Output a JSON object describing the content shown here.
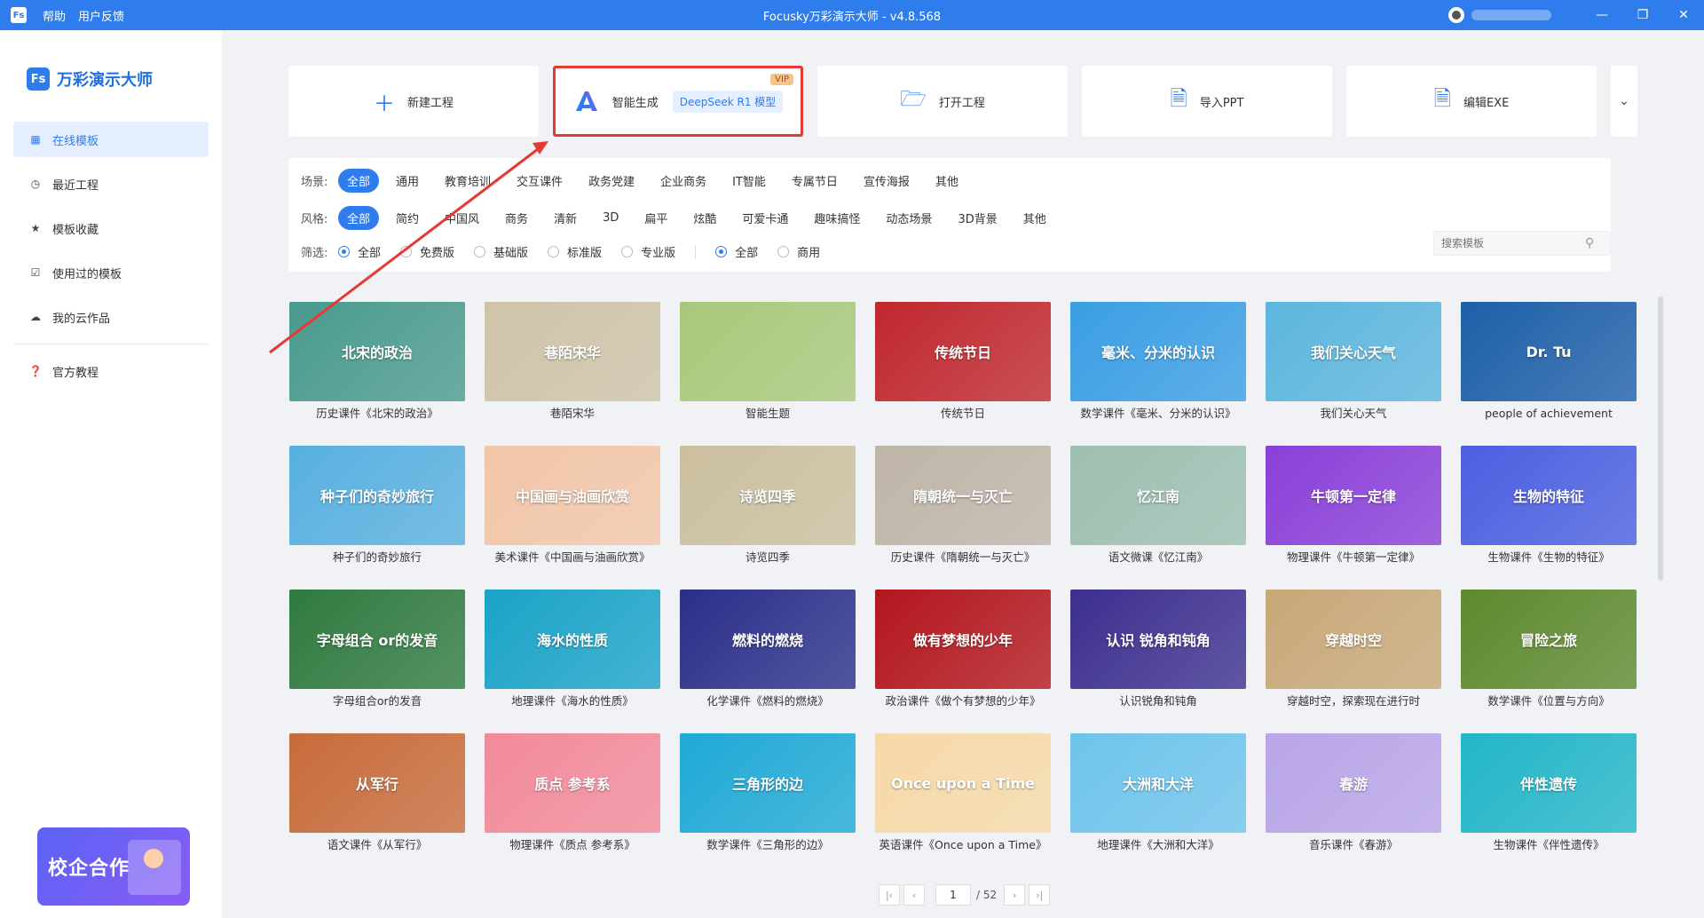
{
  "titlebar": {
    "logo": "Fs",
    "menu": [
      "帮助",
      "用户反馈"
    ],
    "title": "Focusky万彩演示大师 - v4.8.568",
    "controls": [
      "minimize-icon",
      "restore-icon",
      "close-icon"
    ]
  },
  "sidebar": {
    "brand_logo": "Fs",
    "brand_name": "万彩演示大师",
    "items": [
      {
        "label": "在线模板",
        "icon": "grid-icon",
        "active": true
      },
      {
        "label": "最近工程",
        "icon": "clock-icon"
      },
      {
        "label": "模板收藏",
        "icon": "star-icon"
      },
      {
        "label": "使用过的模板",
        "icon": "checkbox-icon"
      },
      {
        "label": "我的云作品",
        "icon": "cloud-icon"
      },
      {
        "label": "官方教程",
        "icon": "help-icon"
      }
    ],
    "promo": "校企合作"
  },
  "actions": {
    "new": "新建工程",
    "ai": "智能生成",
    "ai_badge": "DeepSeek R1 模型",
    "vip": "VIP",
    "open": "打开工程",
    "import": "导入PPT",
    "edit": "编辑EXE"
  },
  "filters": {
    "scene_label": "场景:",
    "scenes": [
      "全部",
      "通用",
      "教育培训",
      "交互课件",
      "政务党建",
      "企业商务",
      "IT智能",
      "专属节日",
      "宣传海报",
      "其他"
    ],
    "style_label": "风格:",
    "styles": [
      "全部",
      "简约",
      "中国风",
      "商务",
      "清新",
      "3D",
      "扁平",
      "炫酷",
      "可爱卡通",
      "趣味搞怪",
      "动态场景",
      "3D背景",
      "其他"
    ],
    "screen_label": "筛选:",
    "versions": [
      "全部",
      "免费版",
      "基础版",
      "标准版",
      "专业版"
    ],
    "usage": [
      "全部",
      "商用"
    ],
    "search_placeholder": "搜索模板"
  },
  "templates": [
    {
      "caption": "历史课件《北宋的政治》",
      "thumb": "北宋的政治",
      "color": "#4a9a8e"
    },
    {
      "caption": "巷陌宋华",
      "thumb": "巷陌宋华",
      "color": "#cfc3a8"
    },
    {
      "caption": "智能生题",
      "thumb": "",
      "color": "#a8c97a"
    },
    {
      "caption": "传统节日",
      "thumb": "传统节日",
      "color": "#c0272d"
    },
    {
      "caption": "数学课件《毫米、分米的认识》",
      "thumb": "毫米、分米的认识",
      "color": "#3a9ee4"
    },
    {
      "caption": "我们关心天气",
      "thumb": "我们关心天气",
      "color": "#5cb6de"
    },
    {
      "caption": "people of achievement",
      "thumb": "Dr. Tu",
      "color": "#1d5fa8"
    },
    {
      "caption": "种子们的奇妙旅行",
      "thumb": "种子们的奇妙旅行",
      "color": "#58b0e0"
    },
    {
      "caption": "美术课件《中国画与油画欣赏》",
      "thumb": "中国画与油画欣赏",
      "color": "#f2c6a8"
    },
    {
      "caption": "诗览四季",
      "thumb": "诗览四季",
      "color": "#cbbf9e"
    },
    {
      "caption": "历史课件《隋朝统一与灭亡》",
      "thumb": "隋朝统一与灭亡",
      "color": "#bfb5a8"
    },
    {
      "caption": "语文微课《忆江南》",
      "thumb": "忆江南",
      "color": "#9dbfb0"
    },
    {
      "caption": "物理课件《牛顿第一定律》",
      "thumb": "牛顿第一定律",
      "color": "#8a3fd8"
    },
    {
      "caption": "生物课件《生物的特征》",
      "thumb": "生物的特征",
      "color": "#4b5fe0"
    },
    {
      "caption": "字母组合or的发音",
      "thumb": "字母组合 or的发音",
      "color": "#2f7a3f"
    },
    {
      "caption": "地理课件《海水的性质》",
      "thumb": "海水的性质",
      "color": "#1aa3c8"
    },
    {
      "caption": "化学课件《燃料的燃烧》",
      "thumb": "燃料的燃烧",
      "color": "#2a2f8a"
    },
    {
      "caption": "政治课件《做个有梦想的少年》",
      "thumb": "做有梦想的少年",
      "color": "#b3161d"
    },
    {
      "caption": "认识锐角和钝角",
      "thumb": "认识 锐角和钝角",
      "color": "#3c2f8f"
    },
    {
      "caption": "穿越时空，探索现在进行时",
      "thumb": "穿越时空",
      "color": "#c8a878"
    },
    {
      "caption": "数学课件《位置与方向》",
      "thumb": "冒险之旅",
      "color": "#5d8a2e"
    },
    {
      "caption": "语文课件《从军行》",
      "thumb": "从军行",
      "color": "#c86b3a"
    },
    {
      "caption": "物理课件《质点 参考系》",
      "thumb": "质点 参考系",
      "color": "#f28a9a"
    },
    {
      "caption": "数学课件《三角形的边》",
      "thumb": "三角形的边",
      "color": "#1fa9d6"
    },
    {
      "caption": "英语课件《Once upon a Time》",
      "thumb": "Once upon a Time",
      "color": "#f6d9a8"
    },
    {
      "caption": "地理课件《大洲和大洋》",
      "thumb": "大洲和大洋",
      "color": "#6ec4ec"
    },
    {
      "caption": "音乐课件《春游》",
      "thumb": "春游",
      "color": "#b9a5e8"
    },
    {
      "caption": "生物课件《伴性遗传》",
      "thumb": "伴性遗传",
      "color": "#22b6c8"
    }
  ],
  "pager": {
    "current": "1",
    "total": "/ 52"
  }
}
